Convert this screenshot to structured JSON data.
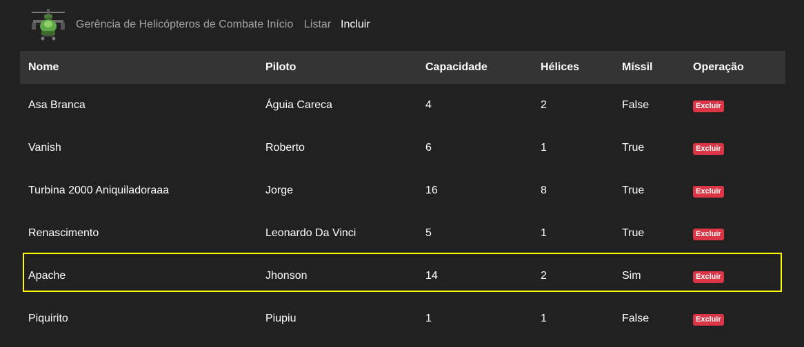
{
  "navbar": {
    "brand": "Gerência de Helicópteros de Combate",
    "links": [
      {
        "label": "Início",
        "active": false
      },
      {
        "label": "Listar",
        "active": false
      },
      {
        "label": "Incluir",
        "active": true
      }
    ],
    "logo_icon": "helicopter-icon"
  },
  "table": {
    "headers": {
      "nome": "Nome",
      "piloto": "Piloto",
      "capacidade": "Capacidade",
      "helices": "Hélices",
      "missil": "Míssil",
      "operacao": "Operação"
    },
    "rows": [
      {
        "nome": "Asa Branca",
        "piloto": "Águia Careca",
        "capacidade": "4",
        "helices": "2",
        "missil": "False",
        "acao": "Excluir"
      },
      {
        "nome": "Vanish",
        "piloto": "Roberto",
        "capacidade": "6",
        "helices": "1",
        "missil": "True",
        "acao": "Excluir"
      },
      {
        "nome": "Turbina 2000 Aniquiladoraaa",
        "piloto": "Jorge",
        "capacidade": "16",
        "helices": "8",
        "missil": "True",
        "acao": "Excluir"
      },
      {
        "nome": "Renascimento",
        "piloto": "Leonardo Da Vinci",
        "capacidade": "5",
        "helices": "1",
        "missil": "True",
        "acao": "Excluir"
      },
      {
        "nome": "Apache",
        "piloto": "Jhonson",
        "capacidade": "14",
        "helices": "2",
        "missil": "Sim",
        "acao": "Excluir"
      },
      {
        "nome": "Piquirito",
        "piloto": "Piupiu",
        "capacidade": "1",
        "helices": "1",
        "missil": "False",
        "acao": "Excluir"
      }
    ]
  },
  "colors": {
    "background": "#212121",
    "header_background": "#343434",
    "danger": "#dc3545",
    "highlight": "#ffff00"
  }
}
